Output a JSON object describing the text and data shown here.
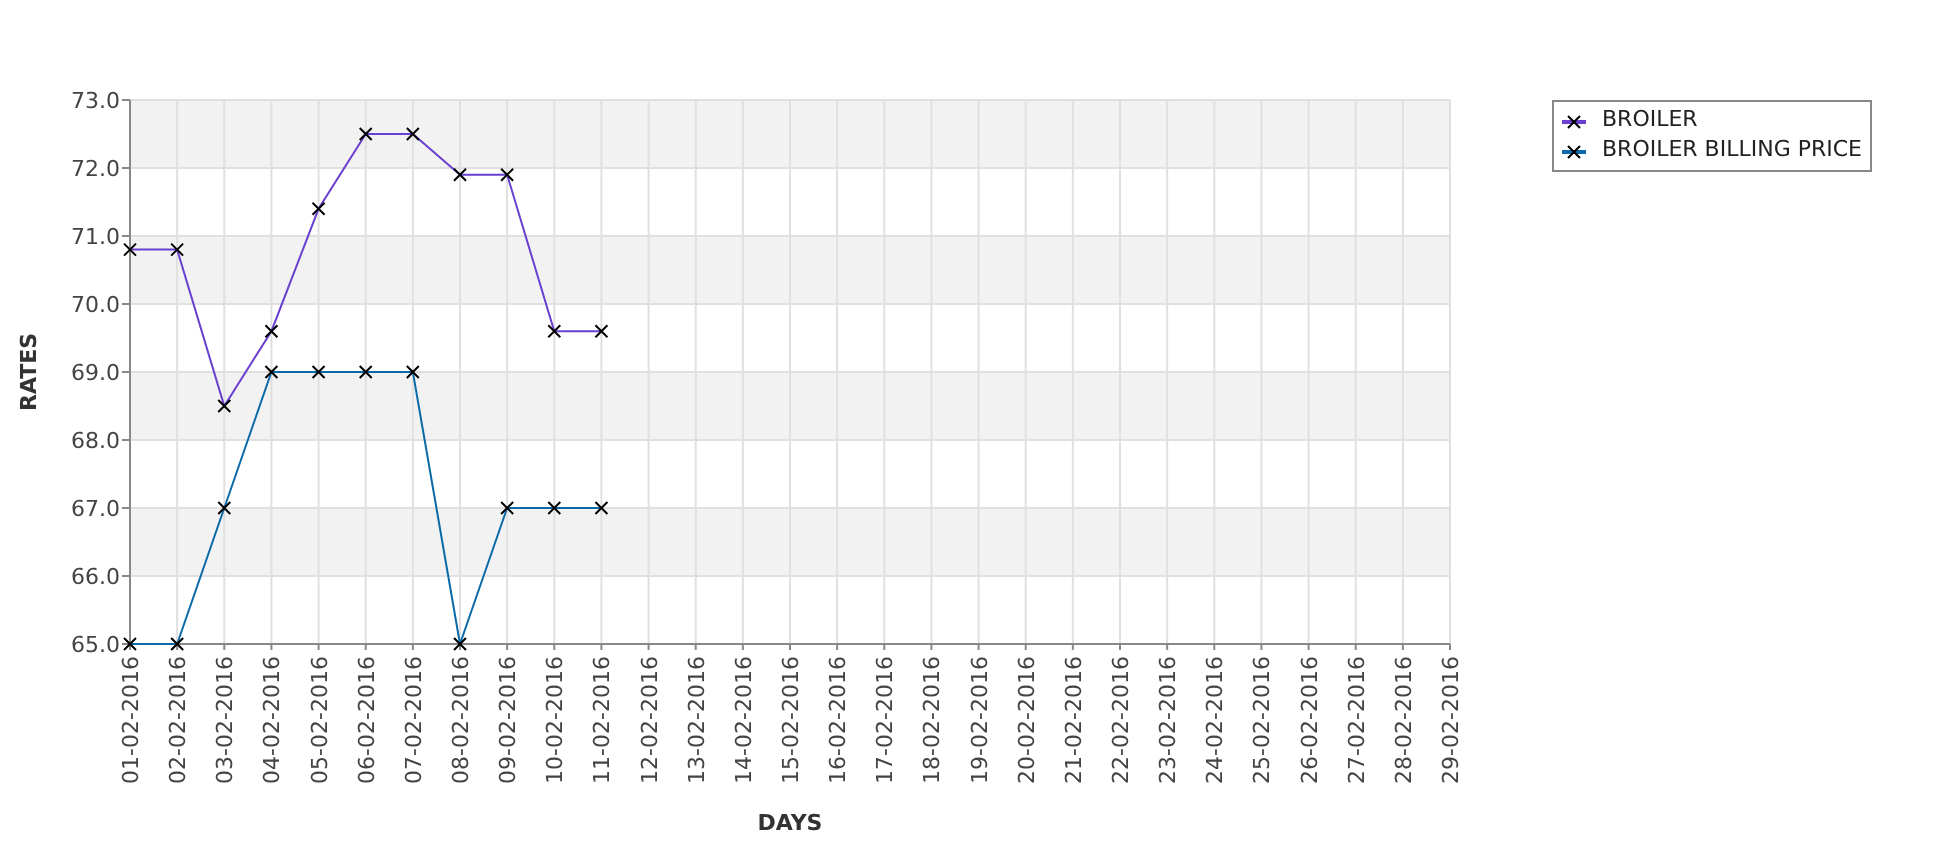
{
  "chart_data": {
    "type": "line",
    "grid": true,
    "xlabel": "DAYS",
    "ylabel": "RATES",
    "categories": [
      "01-02-2016",
      "02-02-2016",
      "03-02-2016",
      "04-02-2016",
      "05-02-2016",
      "06-02-2016",
      "07-02-2016",
      "08-02-2016",
      "09-02-2016",
      "10-02-2016",
      "11-02-2016",
      "12-02-2016",
      "13-02-2016",
      "14-02-2016",
      "15-02-2016",
      "16-02-2016",
      "17-02-2016",
      "18-02-2016",
      "19-02-2016",
      "20-02-2016",
      "21-02-2016",
      "22-02-2016",
      "23-02-2016",
      "24-02-2016",
      "25-02-2016",
      "26-02-2016",
      "27-02-2016",
      "28-02-2016",
      "29-02-2016"
    ],
    "ylim": [
      65,
      73
    ],
    "yticks": [
      {
        "value": 65,
        "label": "65.0"
      },
      {
        "value": 66,
        "label": "66.0"
      },
      {
        "value": 67,
        "label": "67.0"
      },
      {
        "value": 68,
        "label": "68.0"
      },
      {
        "value": 69,
        "label": "69.0"
      },
      {
        "value": 70,
        "label": "70.0"
      },
      {
        "value": 71,
        "label": "71.0"
      },
      {
        "value": 72,
        "label": "72.0"
      },
      {
        "value": 73,
        "label": "73.0"
      }
    ],
    "series": [
      {
        "name": "BROILER",
        "color": "#6a3fd0",
        "marker": "x",
        "values": [
          70.8,
          70.8,
          68.5,
          69.6,
          71.4,
          72.5,
          72.5,
          71.9,
          71.9,
          69.6,
          69.6,
          null,
          null,
          null,
          null,
          null,
          null,
          null,
          null,
          null,
          null,
          null,
          null,
          null,
          null,
          null,
          null,
          null,
          null
        ]
      },
      {
        "name": "BROILER BILLING PRICE",
        "color": "#0a6aa8",
        "marker": "x",
        "values": [
          65,
          65,
          67,
          69,
          69,
          69,
          69,
          65,
          67,
          67,
          67,
          null,
          null,
          null,
          null,
          null,
          null,
          null,
          null,
          null,
          null,
          null,
          null,
          null,
          null,
          null,
          null,
          null,
          null
        ]
      }
    ]
  }
}
